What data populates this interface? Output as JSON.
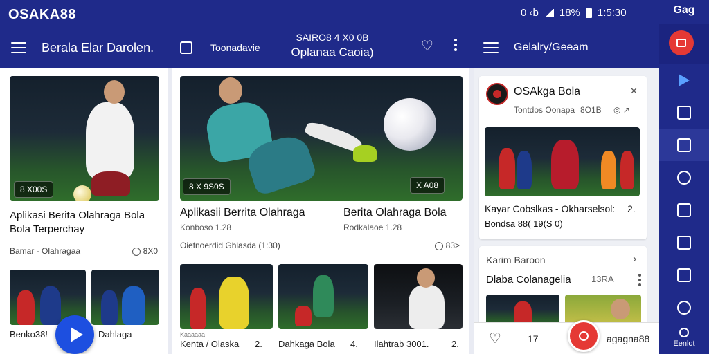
{
  "app": {
    "brand": "OSAKA88"
  },
  "status_bar": {
    "icons_text": "0 ‹b",
    "battery": "18%",
    "time": "1:5:30"
  },
  "header": {
    "col1_title": "Berala Elar Darolen.",
    "col2_sub": "Toonadavie",
    "center_line1": "SAIRO8 4 X0 0B",
    "center_line2": "Oplanaa Caoia)",
    "col3_title": "Gelalry/Geeam"
  },
  "rail": {
    "top_label": "Gag",
    "bottom_label": "Eenlot"
  },
  "col1": {
    "card1_badge": "8 X00S",
    "card1_title": "Aplikasi Berita Olahraga Bola Bola Terperchay",
    "card1_meta": "Bamar - Olahragaa",
    "card1_count": "8X0",
    "thumb1_label": "Benko38!",
    "thumb2_label": "Dahlaga"
  },
  "col2": {
    "hero_badge_left": "8 X 9S0S",
    "hero_badge_right": "X A08",
    "card_a_title": "Aplikasii Berrita Olahraga",
    "card_a_meta": "Konboso 1.28",
    "card_b_title": "Berita Olahraga Bola",
    "card_b_meta": "Rodkalaoe 1.28",
    "meta_row": "Oiefnoerdid Ghlasda (1:30)",
    "meta_count": "83>",
    "thumb1_label": "Kenta / Olaska",
    "thumb1_num": "2.",
    "thumb2_label": "Dahkaga Bola",
    "thumb2_num": "4.",
    "thumb3_label": "Ilahtrab 3001.",
    "thumb3_num": "2.",
    "thumb1_sub": "Kaaaaaa"
  },
  "col3": {
    "panel1_name": "OSAkga Bola",
    "panel1_meta": "Tontdos Oonapa",
    "panel1_meta2": "8O1B",
    "panel1_caption": "Kayar Cobslkas - Okharselsol:",
    "panel1_caption_num": "2.",
    "panel1_caption2": "Bondsa 88( 19(S 0)",
    "panel2_label": "Karim Baroon",
    "panel2_title": "Dlaba Colanagelia",
    "panel2_num": "13RA",
    "bottom_num": "17",
    "bottom_brand": "agagna88"
  }
}
